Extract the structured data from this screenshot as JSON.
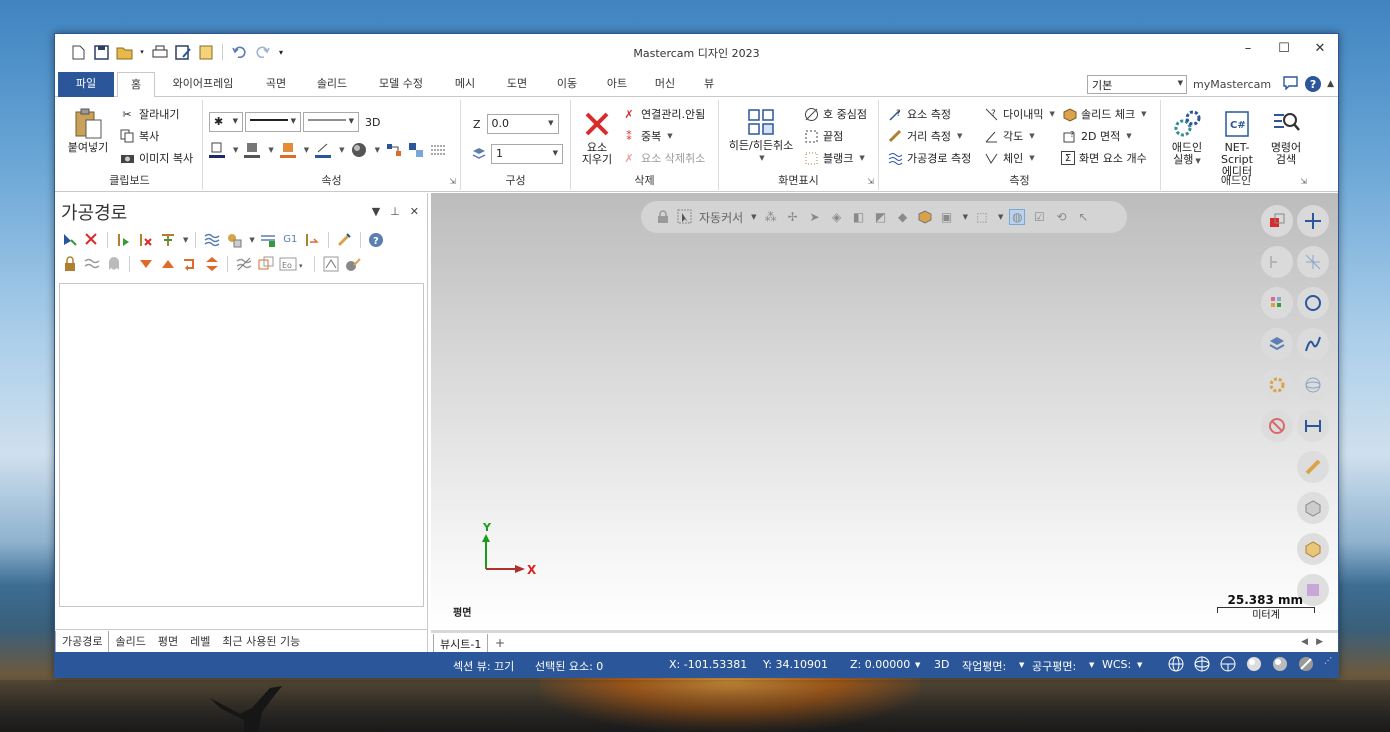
{
  "window": {
    "title": "Mastercam 디자인 2023",
    "minimize": "–",
    "maximize": "☐",
    "close": "✕"
  },
  "menu": {
    "file": "파일",
    "tabs": [
      "홈",
      "와이어프레임",
      "곡면",
      "솔리드",
      "모델 수정",
      "메시",
      "도면",
      "이동",
      "아트",
      "머신",
      "뷰"
    ],
    "active_tab": "홈",
    "config_select": "기본",
    "my_mastercam": "myMastercam"
  },
  "ribbon": {
    "clipboard": {
      "label": "클립보드",
      "paste": "붙여넣기",
      "cut": "잘라내기",
      "copy": "복사",
      "image_copy": "이미지 복사"
    },
    "attributes": {
      "label": "속성",
      "mode_3d": "3D"
    },
    "organize": {
      "label": "구성",
      "z_label": "Z",
      "z_value": "0.0",
      "level_value": "1"
    },
    "delete": {
      "label": "삭제",
      "delete_entities_line1": "요소",
      "delete_entities_line2": "지우기",
      "delete_duplicates": "연결관리.안됨",
      "duplicate": "중복",
      "undelete": "요소 삭제취소"
    },
    "display": {
      "label": "화면표시",
      "hide_unhide": "히든/히든취소",
      "arc_centers": "호 중심점",
      "endpoints": "끝점",
      "blank": "블랭크"
    },
    "analyze": {
      "label": "측정",
      "entity": "요소 측정",
      "distance": "거리 측정",
      "toolpath": "가공경로 측정",
      "dynamic": "다이내믹",
      "angle": "각도",
      "chain": "체인",
      "check_solid": "솔리드 체크",
      "area_2d": "2D 면적",
      "count": "화면 요소 개수"
    },
    "addins": {
      "label": "애드인",
      "run_line1": "애드인",
      "run_line2": "실행",
      "netscript_line1": "NET-Script",
      "netscript_line2": "에디터",
      "cmd_line1": "명령어",
      "cmd_line2": "검색"
    }
  },
  "panel": {
    "title": "가공경로",
    "g1": "G1",
    "tabs": [
      "가공경로",
      "솔리드",
      "평면",
      "레벨",
      "최근 사용된 기능"
    ],
    "active_tab": "가공경로"
  },
  "viewport": {
    "selection_mode": "자동커서",
    "axis_x": "X",
    "axis_y": "Y",
    "plane": "평면",
    "scale_value": "25.383 mm",
    "scale_unit": "미터계"
  },
  "sheets": {
    "active": "뷰시트-1",
    "add": "+"
  },
  "status": {
    "section_view": "섹션 뷰: 끄기",
    "selected": "선택된 요소: 0",
    "x": "X:   -101.53381",
    "y": "Y:   34.10901",
    "z": "Z:   0.00000",
    "mode": "3D",
    "cplane": "작업평면:",
    "tplane": "공구평면:",
    "wcs": "WCS:"
  },
  "colors": {
    "brand_blue": "#2b579a",
    "accent_red": "#d92b2b",
    "axis_green": "#1a9c1a"
  }
}
